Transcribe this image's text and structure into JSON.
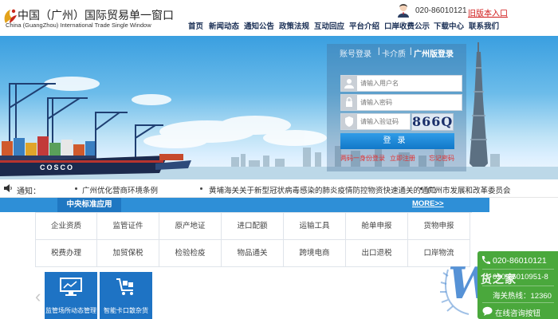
{
  "header": {
    "logo_cn": "中国（广州）国际贸易单一窗口",
    "logo_en": "China (GuangZhou) International Trade Single Window",
    "phone": "020-86010121",
    "old_version_link": "旧版本入口"
  },
  "nav": [
    "首页",
    "新闻动态",
    "通知公告",
    "政策法规",
    "互动回应",
    "平台介绍",
    "口岸收费公示",
    "下载中心",
    "联系我们"
  ],
  "login": {
    "tabs": [
      "账号登录",
      "卡介质",
      "广州版登录"
    ],
    "active_tab": "广州版登录",
    "username_placeholder": "请输入用户名",
    "password_placeholder": "请输入密码",
    "captcha_placeholder": "请输入验证码",
    "captcha_text": "866Q",
    "submit_label": "登录",
    "links": [
      "两码一身份登录",
      "立即注册",
      "忘记密码"
    ]
  },
  "banner": {
    "ship_name": "COSCO"
  },
  "notice": {
    "label": "通知：",
    "items": [
      "广州优化营商环境条例",
      "黄埔海关关于新型冠状病毒感染的肺炎疫情防控物资快速通关的通知",
      "广州市发展和改革委员会"
    ]
  },
  "apps": {
    "tab_label": "中央标准应用",
    "more_label": "MORE>>",
    "grid": [
      [
        "企业资质",
        "监管证件",
        "原产地证",
        "进口配额",
        "运输工具",
        "舱单申报",
        "货物申报"
      ],
      [
        "税费办理",
        "加贸保税",
        "检验检疫",
        "物品通关",
        "跨境电商",
        "出口退税",
        "口岸物流"
      ]
    ],
    "tiles": [
      "监管场所动态管理",
      "智能卡口散杂货"
    ]
  },
  "float_panel": {
    "phone": "020-86010121",
    "line2": "020-86010951-8",
    "hotline_label": "海关热线：12360",
    "online_button": "在线咨询按钮"
  },
  "watermark": {
    "letter": "W",
    "text": "货之家"
  },
  "colors": {
    "nav_text": "#1a2f55",
    "accent_blue": "#2e8fd7",
    "old_version_red": "#d01818",
    "float_green": "#4aa83c"
  }
}
